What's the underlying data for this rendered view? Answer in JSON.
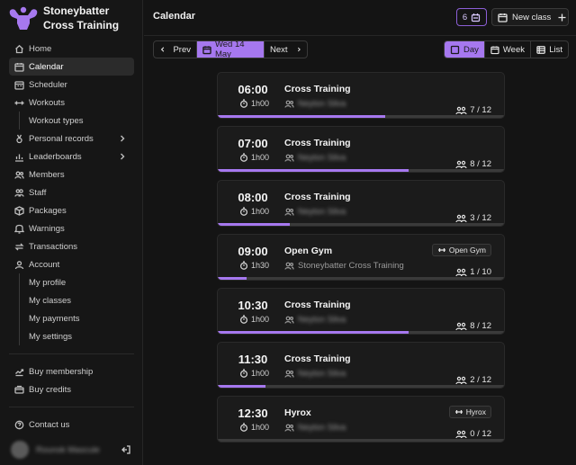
{
  "brand": {
    "line1": "Stoneybatter",
    "line2": "Cross Training",
    "logo_icon": "muscle-figure-icon",
    "logo_color": "#a678ef"
  },
  "sidebar": {
    "items": [
      {
        "label": "Home",
        "icon": "home-icon",
        "active": false
      },
      {
        "label": "Calendar",
        "icon": "calendar-icon",
        "active": true
      },
      {
        "label": "Scheduler",
        "icon": "scheduler-icon",
        "active": false
      },
      {
        "label": "Workouts",
        "icon": "dumbbell-icon",
        "active": false
      },
      {
        "label": "Workout types",
        "sub": true
      },
      {
        "label": "Personal records",
        "icon": "medal-icon",
        "chevron": true
      },
      {
        "label": "Leaderboards",
        "icon": "chart-icon",
        "chevron": true
      },
      {
        "label": "Members",
        "icon": "users-icon"
      },
      {
        "label": "Staff",
        "icon": "staff-icon"
      },
      {
        "label": "Packages",
        "icon": "packages-icon"
      },
      {
        "label": "Warnings",
        "icon": "warning-icon"
      },
      {
        "label": "Transactions",
        "icon": "transactions-icon"
      },
      {
        "label": "Account",
        "icon": "account-icon"
      },
      {
        "label": "My profile",
        "sub": true
      },
      {
        "label": "My classes",
        "sub": true
      },
      {
        "label": "My payments",
        "sub": true
      },
      {
        "label": "My settings",
        "sub": true
      }
    ],
    "secondary": [
      {
        "label": "Buy membership",
        "icon": "membership-icon"
      },
      {
        "label": "Buy credits",
        "icon": "credits-icon"
      }
    ],
    "tertiary": [
      {
        "label": "Contact us",
        "icon": "help-icon"
      }
    ],
    "user_name": "Rounok Mascule"
  },
  "header": {
    "title": "Calendar",
    "count": "6",
    "new_class_label": "New class"
  },
  "toolbar": {
    "prev_label": "Prev",
    "date_label": "Wed 14 May",
    "next_label": "Next",
    "views": [
      "Day",
      "Week",
      "List"
    ],
    "active_view": "Day"
  },
  "accent_color": "#a678ef",
  "classes": [
    {
      "time": "06:00",
      "duration": "1h00",
      "name": "Cross Training",
      "coach": "Neyton Silva",
      "coach_blurred": true,
      "badge": "",
      "booked": 7,
      "capacity": 12,
      "capacity_label": "7 / 12"
    },
    {
      "time": "07:00",
      "duration": "1h00",
      "name": "Cross Training",
      "coach": "Neyton Silva",
      "coach_blurred": true,
      "badge": "",
      "booked": 8,
      "capacity": 12,
      "capacity_label": "8 / 12"
    },
    {
      "time": "08:00",
      "duration": "1h00",
      "name": "Cross Training",
      "coach": "Neyton Silva",
      "coach_blurred": true,
      "badge": "",
      "booked": 3,
      "capacity": 12,
      "capacity_label": "3 / 12"
    },
    {
      "time": "09:00",
      "duration": "1h30",
      "name": "Open Gym",
      "coach": "Stoneybatter Cross Training",
      "coach_blurred": false,
      "badge": "Open Gym",
      "booked": 1,
      "capacity": 10,
      "capacity_label": "1 / 10"
    },
    {
      "time": "10:30",
      "duration": "1h00",
      "name": "Cross Training",
      "coach": "Neyton Silva",
      "coach_blurred": true,
      "badge": "",
      "booked": 8,
      "capacity": 12,
      "capacity_label": "8 / 12"
    },
    {
      "time": "11:30",
      "duration": "1h00",
      "name": "Cross Training",
      "coach": "Neyton Silva",
      "coach_blurred": true,
      "badge": "",
      "booked": 2,
      "capacity": 12,
      "capacity_label": "2 / 12"
    },
    {
      "time": "12:30",
      "duration": "1h00",
      "name": "Hyrox",
      "coach": "Neyton Silva",
      "coach_blurred": true,
      "badge": "Hyrox",
      "booked": 0,
      "capacity": 12,
      "capacity_label": "0 / 12"
    }
  ]
}
